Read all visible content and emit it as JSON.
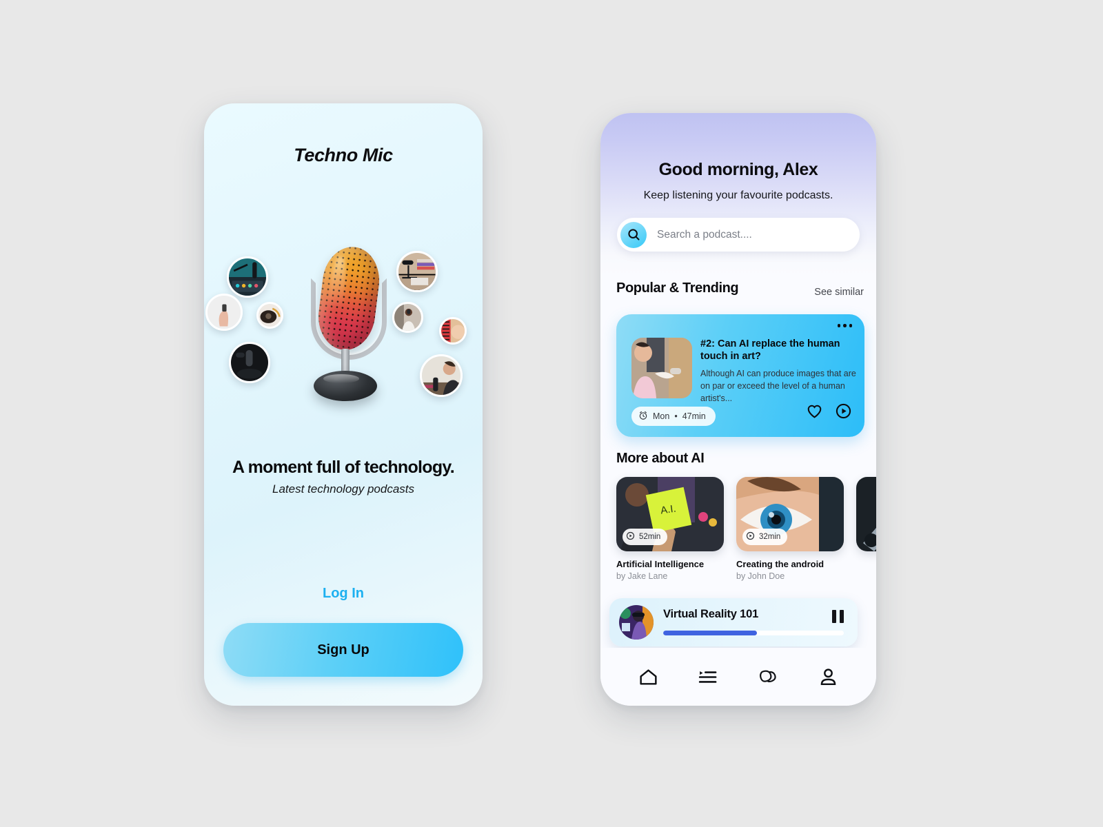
{
  "onboarding": {
    "brand": "Techno Mic",
    "tagline": "A moment full of technology.",
    "subtitle": "Latest technology podcasts",
    "login_label": "Log In",
    "signup_label": "Sign Up",
    "accent_color": "#2fc1fa",
    "link_color": "#1cb0f0",
    "bubbles": [
      {
        "name": "podcast-studio-desk"
      },
      {
        "name": "hand-holding-phone"
      },
      {
        "name": "vintage-camera"
      },
      {
        "name": "black-microphone-dark"
      },
      {
        "name": "mic-laptop-books"
      },
      {
        "name": "person-recording"
      },
      {
        "name": "colorful-mic-closeup"
      },
      {
        "name": "woman-at-mic"
      }
    ]
  },
  "home": {
    "greeting": "Good morning, Alex",
    "greeting_sub": "Keep listening your favourite podcasts.",
    "search": {
      "placeholder": "Search a podcast....",
      "icon": "search-icon"
    },
    "sections": {
      "trending": {
        "title": "Popular & Trending",
        "action": "See similar"
      },
      "more_ai": {
        "title": "More about AI"
      }
    },
    "featured": {
      "title": "#2: Can AI replace the human touch in art?",
      "description": "Although AI can produce images that are on par or exceed the level of a human artist's...",
      "day": "Mon",
      "separator": "•",
      "duration": "47min",
      "clock_icon": "alarm-clock-icon",
      "menu_icon": "more-options-icon",
      "like_icon": "heart-icon",
      "play_icon": "play-circle-icon",
      "thumb": "girl-shaking-robot-hand"
    },
    "cards": [
      {
        "title": "Artificial Intelligence",
        "by": "by Jake Lane",
        "duration": "52min",
        "thumb": "ai-sticky-note"
      },
      {
        "title": "Creating the android",
        "by": "by John Doe",
        "duration": "32min",
        "thumb": "blue-eye-closeup"
      },
      {
        "title": "",
        "by": "",
        "duration": "",
        "thumb": "robot-arm-dark"
      }
    ],
    "player": {
      "title": "Virtual Reality 101",
      "progress_percent": 52,
      "state_icon": "pause-icon",
      "progress_color": "#3f63e0",
      "thumb": "vr-headset-avatar"
    },
    "nav": [
      {
        "label": "Home",
        "icon": "home-icon"
      },
      {
        "label": "Playlist",
        "icon": "playlist-icon"
      },
      {
        "label": "Library",
        "icon": "cards-stack-icon"
      },
      {
        "label": "Profile",
        "icon": "person-icon"
      }
    ]
  }
}
